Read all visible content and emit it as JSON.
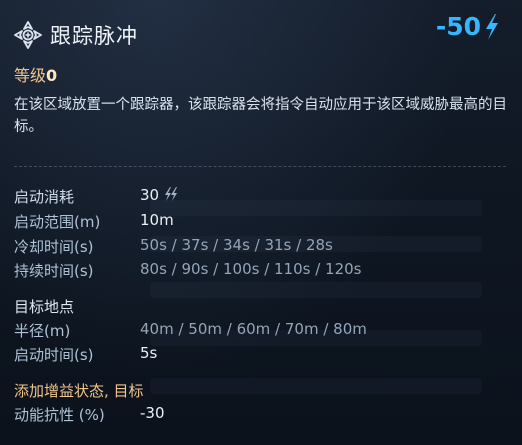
{
  "skill": {
    "title": "跟踪脉冲",
    "cost": "-50",
    "level_label": "等级",
    "level_value": "0",
    "description": "在该区域放置一个跟踪器，该跟踪器会将指令自动应用于该区域威胁最高的目标。"
  },
  "stats": [
    {
      "label": "启动消耗",
      "value": "30"
    },
    {
      "label": "启动范围(m)",
      "value": "10m"
    },
    {
      "label": "冷却时间(s)",
      "value": "50s / 37s / 34s / 31s / 28s"
    },
    {
      "label": "持续时间(s)",
      "value": "80s / 90s / 100s / 110s / 120s"
    }
  ],
  "target_section": {
    "title": "目标地点",
    "rows": [
      {
        "label": "半径(m)",
        "value": "40m / 50m / 60m / 70m / 80m"
      },
      {
        "label": "启动时间(s)",
        "value": "5s"
      }
    ]
  },
  "buff_section": {
    "title": "添加增益状态, 目标",
    "rows": [
      {
        "label": "动能抗性 (%)",
        "value": "-30"
      }
    ]
  },
  "colors": {
    "accent": "#35b6ff",
    "gold": "#f1c68a",
    "background": "#0c1420"
  },
  "icons": {
    "skill": "tracking-pulse-icon",
    "cost": "lightning-icon",
    "energy": "double-lightning-icon"
  }
}
